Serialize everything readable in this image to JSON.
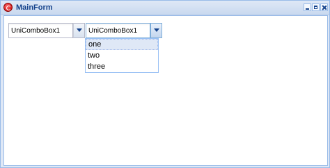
{
  "window": {
    "title": "MainForm",
    "app_icon": "app-logo-icon",
    "controls": [
      "minimize-icon",
      "maximize-icon",
      "close-icon"
    ],
    "colors": {
      "frame": "#99bbe8",
      "title_text": "#15428b",
      "selected_item": "#dfe8f6"
    }
  },
  "combo1": {
    "value": "UniComboBox1",
    "trigger_icon": "chevron-down-icon"
  },
  "combo2": {
    "value": "UniComboBox1",
    "trigger_icon": "chevron-down-icon",
    "expanded": true
  },
  "dropdown": {
    "items": [
      {
        "label": "one",
        "selected": true
      },
      {
        "label": "two",
        "selected": false
      },
      {
        "label": "three",
        "selected": false
      }
    ]
  }
}
